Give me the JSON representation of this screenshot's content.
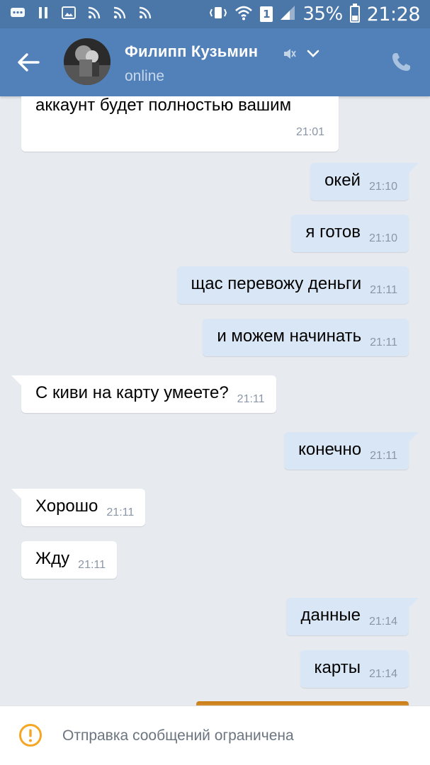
{
  "status_bar": {
    "sim_slot": "1",
    "battery": "35%",
    "battery_level": 0.35,
    "time": "21:28"
  },
  "header": {
    "contact_name": "Филипп Кузьмин",
    "contact_status": "online"
  },
  "messages": [
    {
      "direction": "in",
      "text": "аккаунт будет полностью вашим",
      "time": "21:01"
    },
    {
      "direction": "out",
      "text": "окей",
      "time": "21:10"
    },
    {
      "direction": "out",
      "text": "я готов",
      "time": "21:10"
    },
    {
      "direction": "out",
      "text": "щас перевожу деньги",
      "time": "21:11"
    },
    {
      "direction": "out",
      "text": "и можем начинать",
      "time": "21:11"
    },
    {
      "direction": "in",
      "text": "С киви на карту умеете?",
      "time": "21:11"
    },
    {
      "direction": "out",
      "text": "конечно",
      "time": "21:11"
    },
    {
      "direction": "in",
      "text": "Хорошо",
      "time": "21:11"
    },
    {
      "direction": "in",
      "text": "Жду",
      "time": "21:11"
    },
    {
      "direction": "out",
      "text": "данные",
      "time": "21:14"
    },
    {
      "direction": "out",
      "text": "карты",
      "time": "21:14"
    }
  ],
  "bottom_bar": {
    "restricted_text": "Отправка сообщений ограничена"
  },
  "colors": {
    "status_bar": "#4a76a8",
    "header": "#5181b8",
    "chat_background": "#e7ebf0",
    "incoming_bubble": "#ffffff",
    "outgoing_bubble": "#d9e6f5",
    "warning": "#f5a623"
  },
  "icons": {
    "back": "arrow-left-icon",
    "mute": "muted-speaker-icon",
    "chevron": "chevron-down-icon",
    "call": "phone-icon",
    "warning": "exclamation-circle-icon"
  }
}
